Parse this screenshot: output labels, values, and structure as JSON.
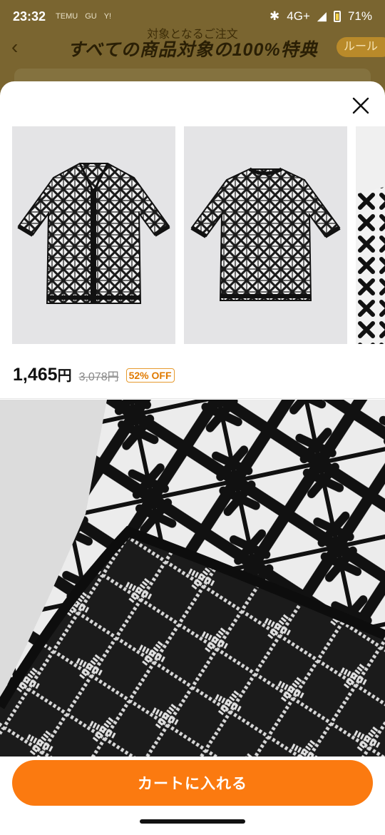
{
  "status_bar": {
    "time": "23:32",
    "apps": [
      "TEMU",
      "GU",
      "Y!"
    ],
    "network": "4G+",
    "battery": "71%"
  },
  "promo": {
    "subtitle": "対象となるご注文",
    "title": "すべての商品対象の100%特典",
    "rule_button": "ルール"
  },
  "product": {
    "price": "1,465",
    "currency": "円",
    "original_price": "3,078円",
    "discount": "52% OFF"
  },
  "actions": {
    "add_to_cart": "カートに入れる"
  },
  "icons": {
    "back": "chevron-left-icon",
    "close": "close-icon"
  },
  "colors": {
    "accent": "#fb7a10",
    "discount": "#e07a00"
  }
}
